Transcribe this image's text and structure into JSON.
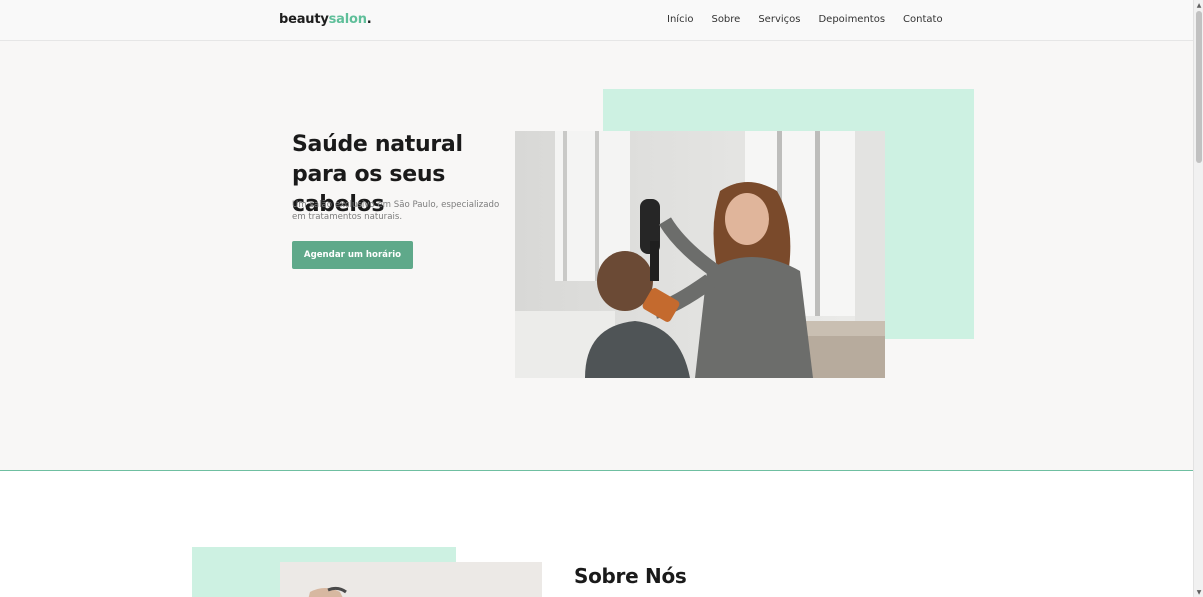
{
  "header": {
    "logo": {
      "part1": "beauty",
      "part2": "salon",
      "part3": "."
    },
    "nav": [
      "Início",
      "Sobre",
      "Serviços",
      "Depoimentos",
      "Contato"
    ]
  },
  "hero": {
    "title": "Saúde natural para os seus cabelos",
    "subtitle": "Um salão exclusivo em São Paulo, especializado em tratamentos naturais.",
    "cta": "Agendar um horário"
  },
  "about": {
    "title": "Sobre Nós"
  },
  "colors": {
    "accent": "#5fa98a",
    "logo_accent": "#5fbf9a",
    "mint": "#cdf1e2"
  }
}
